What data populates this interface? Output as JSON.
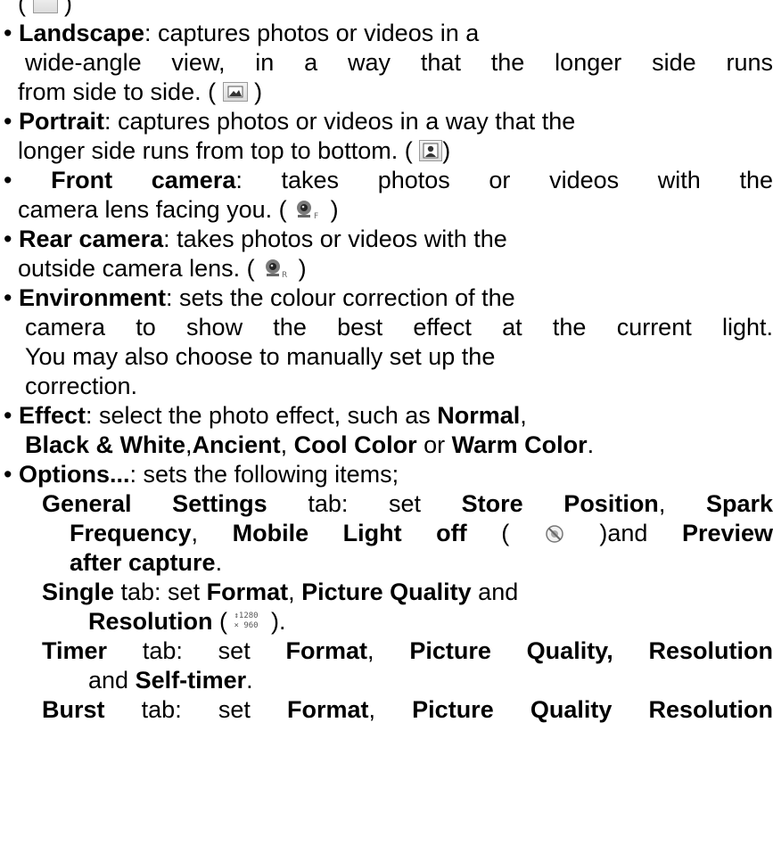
{
  "lines": {
    "l0": "( ",
    "l0_close": " )",
    "landscape": {
      "bullet": "•",
      "term": "Landscape",
      "text1": ": captures photos or videos in a",
      "text2": "wide-angle view, in a way that the longer side runs",
      "text3": "from side to side. ( ",
      "text3_close": " )",
      "icon": "landscape-icon"
    },
    "portrait": {
      "bullet": "•",
      "term": "Portrait",
      "text1": ": captures photos or videos in a way that the",
      "text2": "longer side runs from top to bottom. ( ",
      "text2_close": ")",
      "icon": "portrait-icon"
    },
    "front": {
      "bullet": "•",
      "term": "Front camera",
      "text1": ": takes photos or videos with the",
      "text2": "camera lens facing you. ( ",
      "text2_close": " )",
      "icon": "front-camera-icon"
    },
    "rear": {
      "bullet": "•",
      "term": "Rear camera",
      "text1": ": takes photos or videos with the",
      "text2": "outside camera lens. ( ",
      "text2_close": " )",
      "icon": "rear-camera-icon"
    },
    "environment": {
      "bullet": "•",
      "term": "Environment",
      "text1": ": sets the colour correction of the",
      "text2": "camera to show the best effect at the current light.",
      "text3": "You may also choose to manually set up the",
      "text4": "correction."
    },
    "effect": {
      "bullet": "•",
      "term": "Effect",
      "text1": ": select the photo effect, such as ",
      "normal": "Normal",
      "comma1": ",",
      "bw": "Black & White",
      "comma2": ",",
      "ancient": "Ancient",
      "comma3": ", ",
      "cool": "Cool Color",
      "or": " or ",
      "warm": "Warm Color",
      "period": "."
    },
    "options": {
      "bullet": "•",
      "term": "Options...",
      "text1": ": sets the following items;"
    },
    "general": {
      "term": "General Settings",
      "tab": " tab: set ",
      "store": "Store Position",
      "comma": ", ",
      "spark": "Spark",
      "freq": "Frequency",
      "comma2": ", ",
      "mobile": "Mobile Light off",
      "paren": " ( ",
      "paren_close": " )and ",
      "preview": "Preview",
      "after": "after capture",
      "period": ".",
      "icon": "mobile-light-off-icon"
    },
    "single": {
      "term": "Single",
      "tab": " tab: set ",
      "format": "Format",
      "comma": ", ",
      "quality": "Picture Quality",
      "and": " and",
      "resolution": "Resolution",
      "paren": " ( ",
      "paren_close": " ).",
      "res_top": "↕1280",
      "res_bottom": "× 960",
      "icon": "resolution-icon"
    },
    "timer": {
      "term": "Timer",
      "tab": " tab: set ",
      "format": "Format",
      "comma": ", ",
      "quality_res": "Picture Quality, Resolution",
      "and": "and ",
      "self": "Self-timer",
      "period": "."
    },
    "burst": {
      "term": "Burst",
      "tab": " tab: set ",
      "format": "Format",
      "comma": ", ",
      "quality_res": "Picture Quality Resolution"
    }
  },
  "colors": {
    "text": "#000000",
    "icon_border": "#9a9a9a"
  }
}
